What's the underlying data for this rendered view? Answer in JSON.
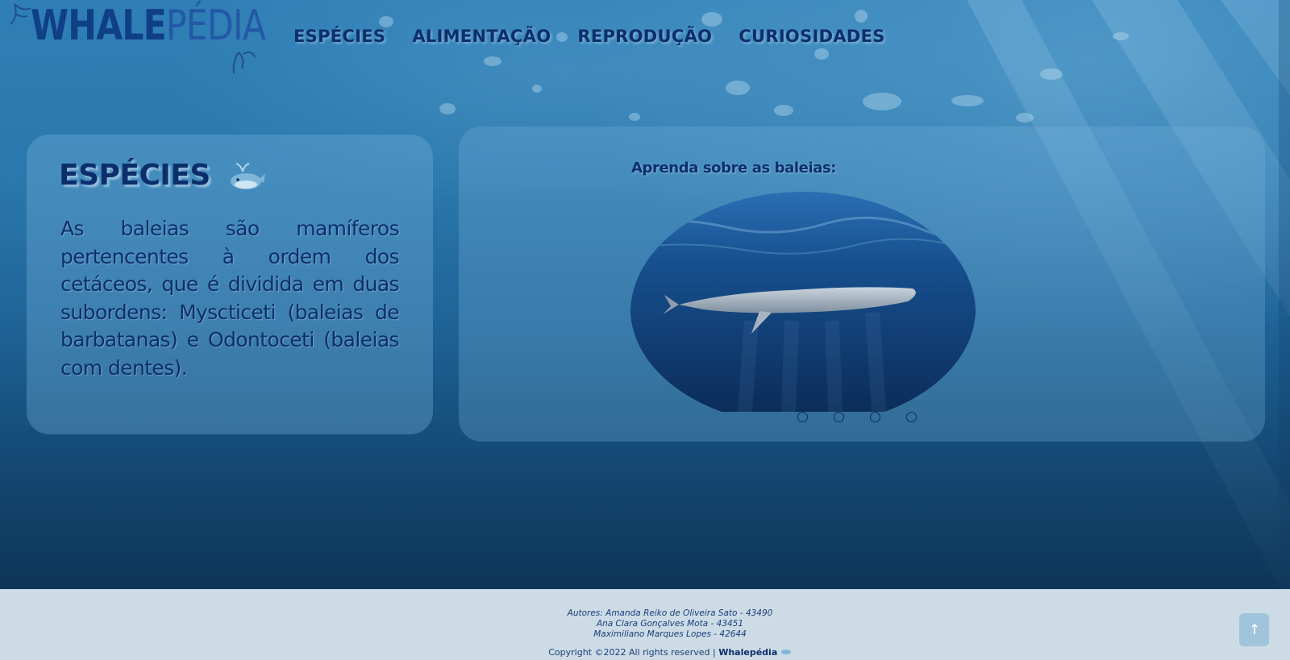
{
  "header": {
    "logo_bold": "WHALE",
    "logo_light": "PÉDIA",
    "nav": [
      {
        "label": "ESPÉCIES"
      },
      {
        "label": "ALIMENTAÇÃO"
      },
      {
        "label": "REPRODUÇÃO"
      },
      {
        "label": "CURIOSIDADES"
      }
    ]
  },
  "species_card": {
    "title": "ESPÉCIES",
    "title_icon": "whale-icon",
    "body": "As baleias são mamíferos pertencentes à ordem dos cetáceos, que é dividida em duas subordens: Myscticeti (baleias de barbatanas) e Odontoceti (baleias com dentes)."
  },
  "carousel": {
    "caption": "Aprenda sobre as baleias:",
    "image_icon": "whale-photo",
    "slide_count": 4,
    "active_slide": 1
  },
  "footer": {
    "authors_line1": "Autores: Amanda Reiko de Oliveira Sato - 43490",
    "authors_line2": "Ana Clara Gonçalves Mota - 43451",
    "authors_line3": "Maximiliano Marques Lopes - 42644",
    "copyright": "Copyright ©2022 All rights reserved |",
    "brand": "Whalepédia",
    "to_top_icon": "arrow-up-icon"
  },
  "colors": {
    "text_dark_blue": "#0c2f6b",
    "ocean_top": "#2f7fb6",
    "ocean_bottom": "#0d3558",
    "footer_bg": "#ccdbe6",
    "to_top_bg": "#9fc4dc"
  }
}
